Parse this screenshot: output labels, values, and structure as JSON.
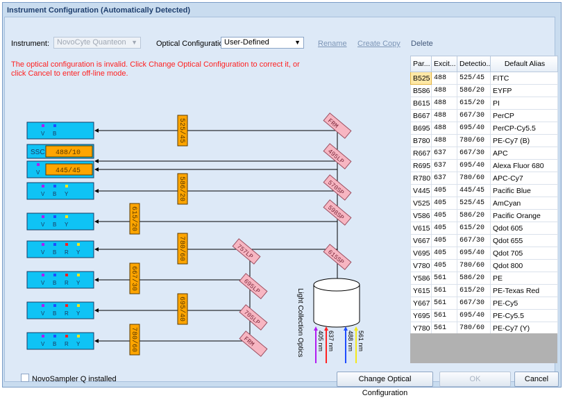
{
  "window": {
    "title": "Instrument Configuration (Automatically Detected)"
  },
  "toolbar": {
    "instrument_label": "Instrument:",
    "instrument_value": "NovoCyte Quanteon",
    "optical_label": "Optical Configuration:",
    "optical_value": "User-Defined",
    "rename_label": "Rename",
    "copy_label": "Create Copy",
    "delete_label": "Delete"
  },
  "error_message": "The optical configuration is invalid. Click Change Optical Configuration to correct it, or click Cancel to enter off-line mode.",
  "diagram": {
    "bandpass_filters": [
      "525/45",
      "586/20",
      "615/20",
      "780/60",
      "667/30",
      "695/40",
      "780/60"
    ],
    "dichroic_filters": [
      "FRM",
      "495LP",
      "570SP",
      "598SP",
      "757LP",
      "615SP",
      "695LP",
      "705LP",
      "FRM"
    ],
    "ssc_label": "SSC:",
    "ssc_filter": "488/10",
    "v_filter": "445/45",
    "detector_rows": [
      [
        "V",
        "B"
      ],
      [
        "V",
        "B",
        "Y"
      ],
      [
        "V",
        "B",
        "Y"
      ],
      [
        "V",
        "B",
        "R",
        "Y"
      ],
      [
        "V",
        "B",
        "R",
        "Y"
      ],
      [
        "V",
        "B",
        "R",
        "Y"
      ],
      [
        "V",
        "B",
        "R",
        "Y"
      ]
    ],
    "optics_label": "Light Collection Optics",
    "lasers": [
      "405 nm",
      "637 nm",
      "488 nm",
      "561 nm"
    ],
    "colors": {
      "detector": "#0fc3f5",
      "filter": "#ffa500",
      "dichroic": "#f7b6c2",
      "violet": "#b01cf2",
      "blue": "#1e4cff",
      "red": "#ff2020",
      "yellow": "#f4e81a"
    }
  },
  "table": {
    "headers": [
      "Par...",
      "Excit...",
      "Detectio...",
      "Default Alias"
    ],
    "rows": [
      [
        "B525",
        "488",
        "525/45",
        "FITC"
      ],
      [
        "B586",
        "488",
        "586/20",
        "EYFP"
      ],
      [
        "B615",
        "488",
        "615/20",
        "PI"
      ],
      [
        "B667",
        "488",
        "667/30",
        "PerCP"
      ],
      [
        "B695",
        "488",
        "695/40",
        "PerCP-Cy5.5"
      ],
      [
        "B780",
        "488",
        "780/60",
        "PE-Cy7 (B)"
      ],
      [
        "R667",
        "637",
        "667/30",
        "APC"
      ],
      [
        "R695",
        "637",
        "695/40",
        "Alexa Fluor 680"
      ],
      [
        "R780",
        "637",
        "780/60",
        "APC-Cy7"
      ],
      [
        "V445",
        "405",
        "445/45",
        "Pacific Blue"
      ],
      [
        "V525",
        "405",
        "525/45",
        "AmCyan"
      ],
      [
        "V586",
        "405",
        "586/20",
        "Pacific Orange"
      ],
      [
        "V615",
        "405",
        "615/20",
        "Qdot 605"
      ],
      [
        "V667",
        "405",
        "667/30",
        "Qdot 655"
      ],
      [
        "V695",
        "405",
        "695/40",
        "Qdot 705"
      ],
      [
        "V780",
        "405",
        "780/60",
        "Qdot 800"
      ],
      [
        "Y586",
        "561",
        "586/20",
        "PE"
      ],
      [
        "Y615",
        "561",
        "615/20",
        "PE-Texas Red"
      ],
      [
        "Y667",
        "561",
        "667/30",
        "PE-Cy5"
      ],
      [
        "Y695",
        "561",
        "695/40",
        "PE-Cy5.5"
      ],
      [
        "Y780",
        "561",
        "780/60",
        "PE-Cy7 (Y)"
      ]
    ]
  },
  "footer": {
    "sampler_label": "NovoSampler Q installed",
    "change_button": "Change Optical Configuration",
    "ok_button": "OK",
    "cancel_button": "Cancel"
  }
}
